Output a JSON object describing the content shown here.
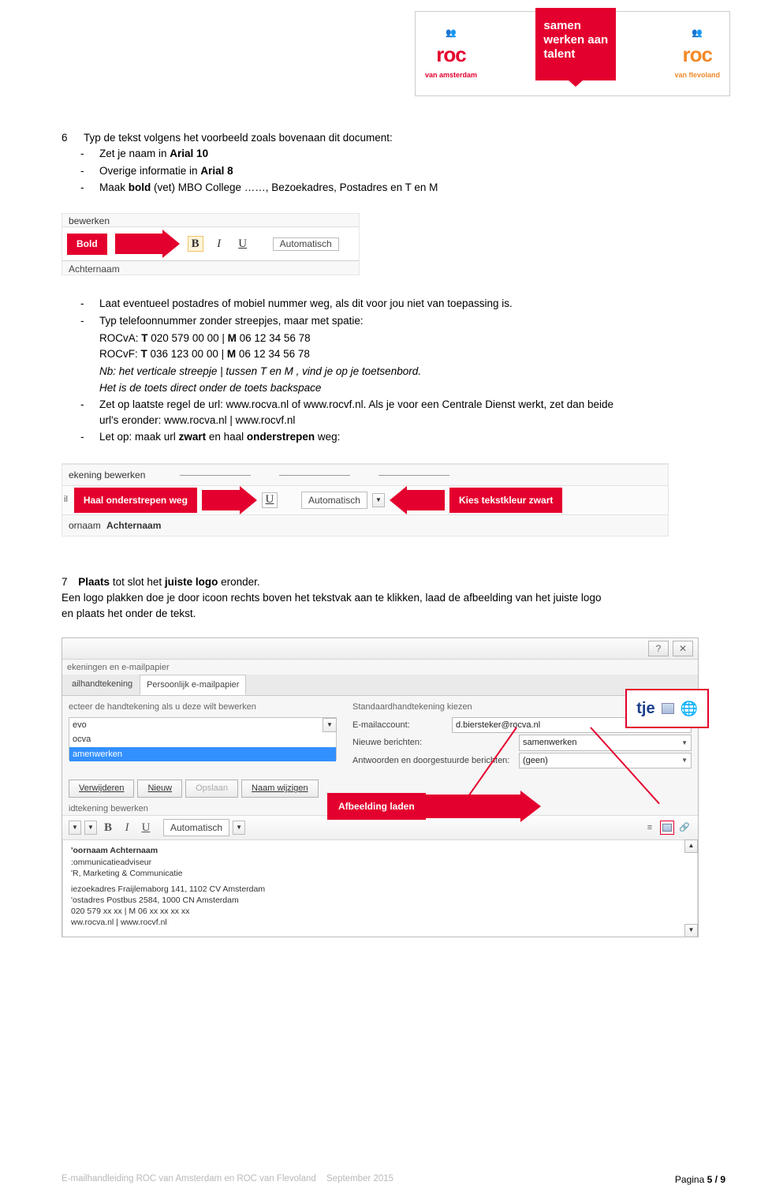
{
  "logobox": {
    "left_roc": "roc",
    "left_sub": "van amsterdam",
    "center_l1": "samen",
    "center_l2": "werken aan",
    "center_l3": "talent",
    "right_roc": "roc",
    "right_sub": "van flevoland"
  },
  "step6": {
    "num": "6",
    "intro": "Typ de tekst volgens het voorbeeld zoals bovenaan dit document:",
    "b1_pre": "Zet je naam in ",
    "b1_bold": "Arial 10",
    "b2_pre": "Overige informatie in ",
    "b2_bold": "Arial 8",
    "b3_pre": "Maak ",
    "b3_bold": "bold",
    "b3_post": " (vet) MBO College ……, Bezoekadres, Postadres en T en M"
  },
  "fig1": {
    "bewerken": "bewerken",
    "bold_tag": "Bold",
    "b": "B",
    "i": "I",
    "u": "U",
    "auto": "Automatisch",
    "achternaam": "Achternaam"
  },
  "midlist": {
    "l1": "Laat eventueel postadres of mobiel nummer weg, als dit voor jou niet van toepassing is.",
    "l2": "Typ telefoonnummer zonder streepjes, maar met spatie:",
    "rva_lbl": "ROCvA:  ",
    "rva_t": "T",
    "rva_num": " 020 579 00 00 | ",
    "rva_m": "M",
    "rva_mob": " 06 12 34 56 78",
    "rvf_lbl": "ROCvF:  ",
    "rvf_t": "T",
    "rvf_num": " 036 123 00 00 | ",
    "rvf_m": "M",
    "rvf_mob": " 06 12 34 56 78",
    "nb": "Nb: het verticale streepje | tussen T en M , vind je op je toetsenbord.",
    "nb2": "Het is de toets direct onder de toets backspace",
    "l3a": "Zet op laatste regel de url: www.rocva.nl of www.rocvf.nl. Als je voor een Centrale Dienst werkt, zet dan beide",
    "l3b": "url's eronder: www.rocva.nl | www.rocvf.nl",
    "l4_pre": "Let op: maak url ",
    "l4_b1": "zwart",
    "l4_mid": " en haal ",
    "l4_b2": "onderstrepen",
    "l4_post": " weg:"
  },
  "fig2": {
    "top": "ekening bewerken",
    "left_tag": "Haal onderstrepen weg",
    "u": "U",
    "auto": "Automatisch",
    "right_tag": "Kies tekstkleur zwart",
    "bottom_pre": "ornaam",
    "bottom_bold": "Achternaam",
    "dd_small": "il"
  },
  "step7": {
    "num": "7",
    "intro_b1": "Plaats",
    "intro_mid": " tot slot het ",
    "intro_b2": "juiste logo",
    "intro_post": " eronder.",
    "p1": "Een logo plakken doe je door icoon rechts boven het tekstvak aan te klikken, laad de afbeelding van het juiste logo",
    "p2": "en plaats het onder de tekst."
  },
  "fig3": {
    "tab1": "ekeningen en e-mailpapier",
    "tab_left1": "ailhandtekening",
    "tab_left2": "Persoonlijk e-mailpapier",
    "left_title": "ecteer de handtekening als u deze wilt bewerken",
    "list_item1": "evo",
    "list_item2": "ocva",
    "list_item3": "amenwerken",
    "right_title": "Standaardhandtekening kiezen",
    "r_lbl1": "E-mailaccount:",
    "r_val1": "d.biersteker@rocva.nl",
    "r_lbl2": "Nieuwe berichten:",
    "r_val2": "samenwerken",
    "r_lbl3": "Antwoorden en doorgestuurde berichten:",
    "r_val3": "(geen)",
    "btn_del": "Verwijderen",
    "btn_new": "Nieuw",
    "btn_save": "Opslaan",
    "btn_rename": "Naam wijzigen",
    "edit_title": "idtekening bewerken",
    "tb_b": "B",
    "tb_i": "I",
    "tb_u": "U",
    "tb_auto": "Automatisch",
    "sig_name": "'oornaam Achternaam",
    "sig_role1": ":ommunicatieadviseur",
    "sig_role2": "'R, Marketing & Communicatie",
    "sig_addr1": "iezoekadres Fraijlemaborg 141, 1102 CV Amsterdam",
    "sig_addr2": "'ostadres Postbus 2584, 1000 CN Amsterdam",
    "sig_tel": " 020 579 xx xx | M 06 xx xx xx xx",
    "sig_url": "ww.rocva.nl | www.rocvf.nl",
    "afbeelding_tag": "Afbeelding laden",
    "callout_label": "tje"
  },
  "footer": {
    "left_1": "E-mailhandleiding ROC van Amsterdam en ROC van Flevoland",
    "left_2": "September 2015",
    "page_label": "Pagina ",
    "page_cur": "5",
    "page_sep": " / ",
    "page_total": "9"
  }
}
